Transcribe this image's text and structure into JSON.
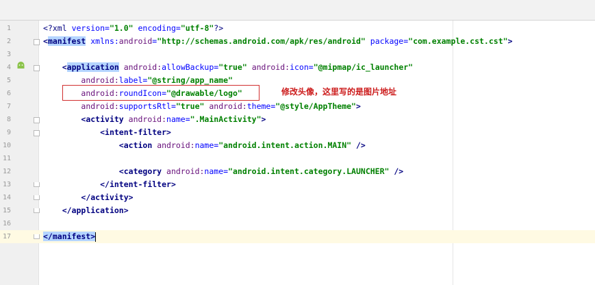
{
  "editor": {
    "lines": [
      {
        "n": "1",
        "segs": [
          {
            "t": "<?",
            "c": "pi"
          },
          {
            "t": "xml",
            "c": "pi"
          },
          {
            "t": " version=",
            "c": "attr"
          },
          {
            "t": "\"1.0\"",
            "c": "val"
          },
          {
            "t": " encoding=",
            "c": "attr"
          },
          {
            "t": "\"utf-8\"",
            "c": "val"
          },
          {
            "t": "?>",
            "c": "pi"
          }
        ]
      },
      {
        "n": "2",
        "segs": [
          {
            "t": "<",
            "c": "tag"
          },
          {
            "t": "manifest",
            "c": "tag hl"
          },
          {
            "t": " xmlns:",
            "c": "attr"
          },
          {
            "t": "android",
            "c": "ns"
          },
          {
            "t": "=",
            "c": "attr"
          },
          {
            "t": "\"http://schemas.android.com/apk/res/android\"",
            "c": "val"
          },
          {
            "t": " package=",
            "c": "attr"
          },
          {
            "t": "\"com.example.cst.cst\"",
            "c": "val"
          },
          {
            "t": ">",
            "c": "tag"
          }
        ]
      },
      {
        "n": "3",
        "segs": []
      },
      {
        "n": "4",
        "segs": [
          {
            "t": "    ",
            "c": ""
          },
          {
            "t": "<",
            "c": "tag"
          },
          {
            "t": "application",
            "c": "tag hl"
          },
          {
            "t": " android:",
            "c": "ns"
          },
          {
            "t": "allowBackup=",
            "c": "attr"
          },
          {
            "t": "\"true\"",
            "c": "val"
          },
          {
            "t": " android:",
            "c": "ns"
          },
          {
            "t": "icon=",
            "c": "attr"
          },
          {
            "t": "\"@mipmap/ic_launcher\"",
            "c": "val"
          }
        ]
      },
      {
        "n": "5",
        "segs": [
          {
            "t": "        ",
            "c": ""
          },
          {
            "t": "android:",
            "c": "ns"
          },
          {
            "t": "label=",
            "c": "attr"
          },
          {
            "t": "\"@string/app_name\"",
            "c": "val"
          }
        ]
      },
      {
        "n": "6",
        "segs": [
          {
            "t": "        ",
            "c": ""
          },
          {
            "t": "android:",
            "c": "ns"
          },
          {
            "t": "roundIcon=",
            "c": "attr"
          },
          {
            "t": "\"@drawable/logo\"",
            "c": "val"
          }
        ]
      },
      {
        "n": "7",
        "segs": [
          {
            "t": "        ",
            "c": ""
          },
          {
            "t": "android:",
            "c": "ns"
          },
          {
            "t": "supportsRtl=",
            "c": "attr"
          },
          {
            "t": "\"true\"",
            "c": "val"
          },
          {
            "t": " android:",
            "c": "ns"
          },
          {
            "t": "theme=",
            "c": "attr"
          },
          {
            "t": "\"@style/AppTheme\"",
            "c": "val"
          },
          {
            "t": ">",
            "c": "tag"
          }
        ]
      },
      {
        "n": "8",
        "segs": [
          {
            "t": "        ",
            "c": ""
          },
          {
            "t": "<",
            "c": "tag"
          },
          {
            "t": "activity",
            "c": "tag"
          },
          {
            "t": " android:",
            "c": "ns"
          },
          {
            "t": "name=",
            "c": "attr"
          },
          {
            "t": "\".MainActivity\"",
            "c": "val"
          },
          {
            "t": ">",
            "c": "tag"
          }
        ]
      },
      {
        "n": "9",
        "segs": [
          {
            "t": "            ",
            "c": ""
          },
          {
            "t": "<intent-filter>",
            "c": "tag"
          }
        ]
      },
      {
        "n": "10",
        "segs": [
          {
            "t": "                ",
            "c": ""
          },
          {
            "t": "<",
            "c": "tag"
          },
          {
            "t": "action",
            "c": "tag"
          },
          {
            "t": " android:",
            "c": "ns"
          },
          {
            "t": "name=",
            "c": "attr"
          },
          {
            "t": "\"android.intent.action.MAIN\"",
            "c": "val"
          },
          {
            "t": " />",
            "c": "tag"
          }
        ]
      },
      {
        "n": "11",
        "segs": []
      },
      {
        "n": "12",
        "segs": [
          {
            "t": "                ",
            "c": ""
          },
          {
            "t": "<",
            "c": "tag"
          },
          {
            "t": "category",
            "c": "tag"
          },
          {
            "t": " android:",
            "c": "ns"
          },
          {
            "t": "name=",
            "c": "attr"
          },
          {
            "t": "\"android.intent.category.LAUNCHER\"",
            "c": "val"
          },
          {
            "t": " />",
            "c": "tag"
          }
        ]
      },
      {
        "n": "13",
        "segs": [
          {
            "t": "            ",
            "c": ""
          },
          {
            "t": "</intent-filter>",
            "c": "tag"
          }
        ]
      },
      {
        "n": "14",
        "segs": [
          {
            "t": "        ",
            "c": ""
          },
          {
            "t": "</activity>",
            "c": "tag"
          }
        ]
      },
      {
        "n": "15",
        "segs": [
          {
            "t": "    ",
            "c": ""
          },
          {
            "t": "</application>",
            "c": "tag"
          }
        ]
      },
      {
        "n": "16",
        "segs": []
      },
      {
        "n": "17",
        "segs": [
          {
            "t": "</manifest>",
            "c": "tag hl"
          }
        ]
      }
    ]
  },
  "annotation": {
    "text": "修改头像，这里写的是图片地址",
    "color": "#cc1c1c"
  },
  "icons": {
    "gutter_line4": "android-icon"
  }
}
